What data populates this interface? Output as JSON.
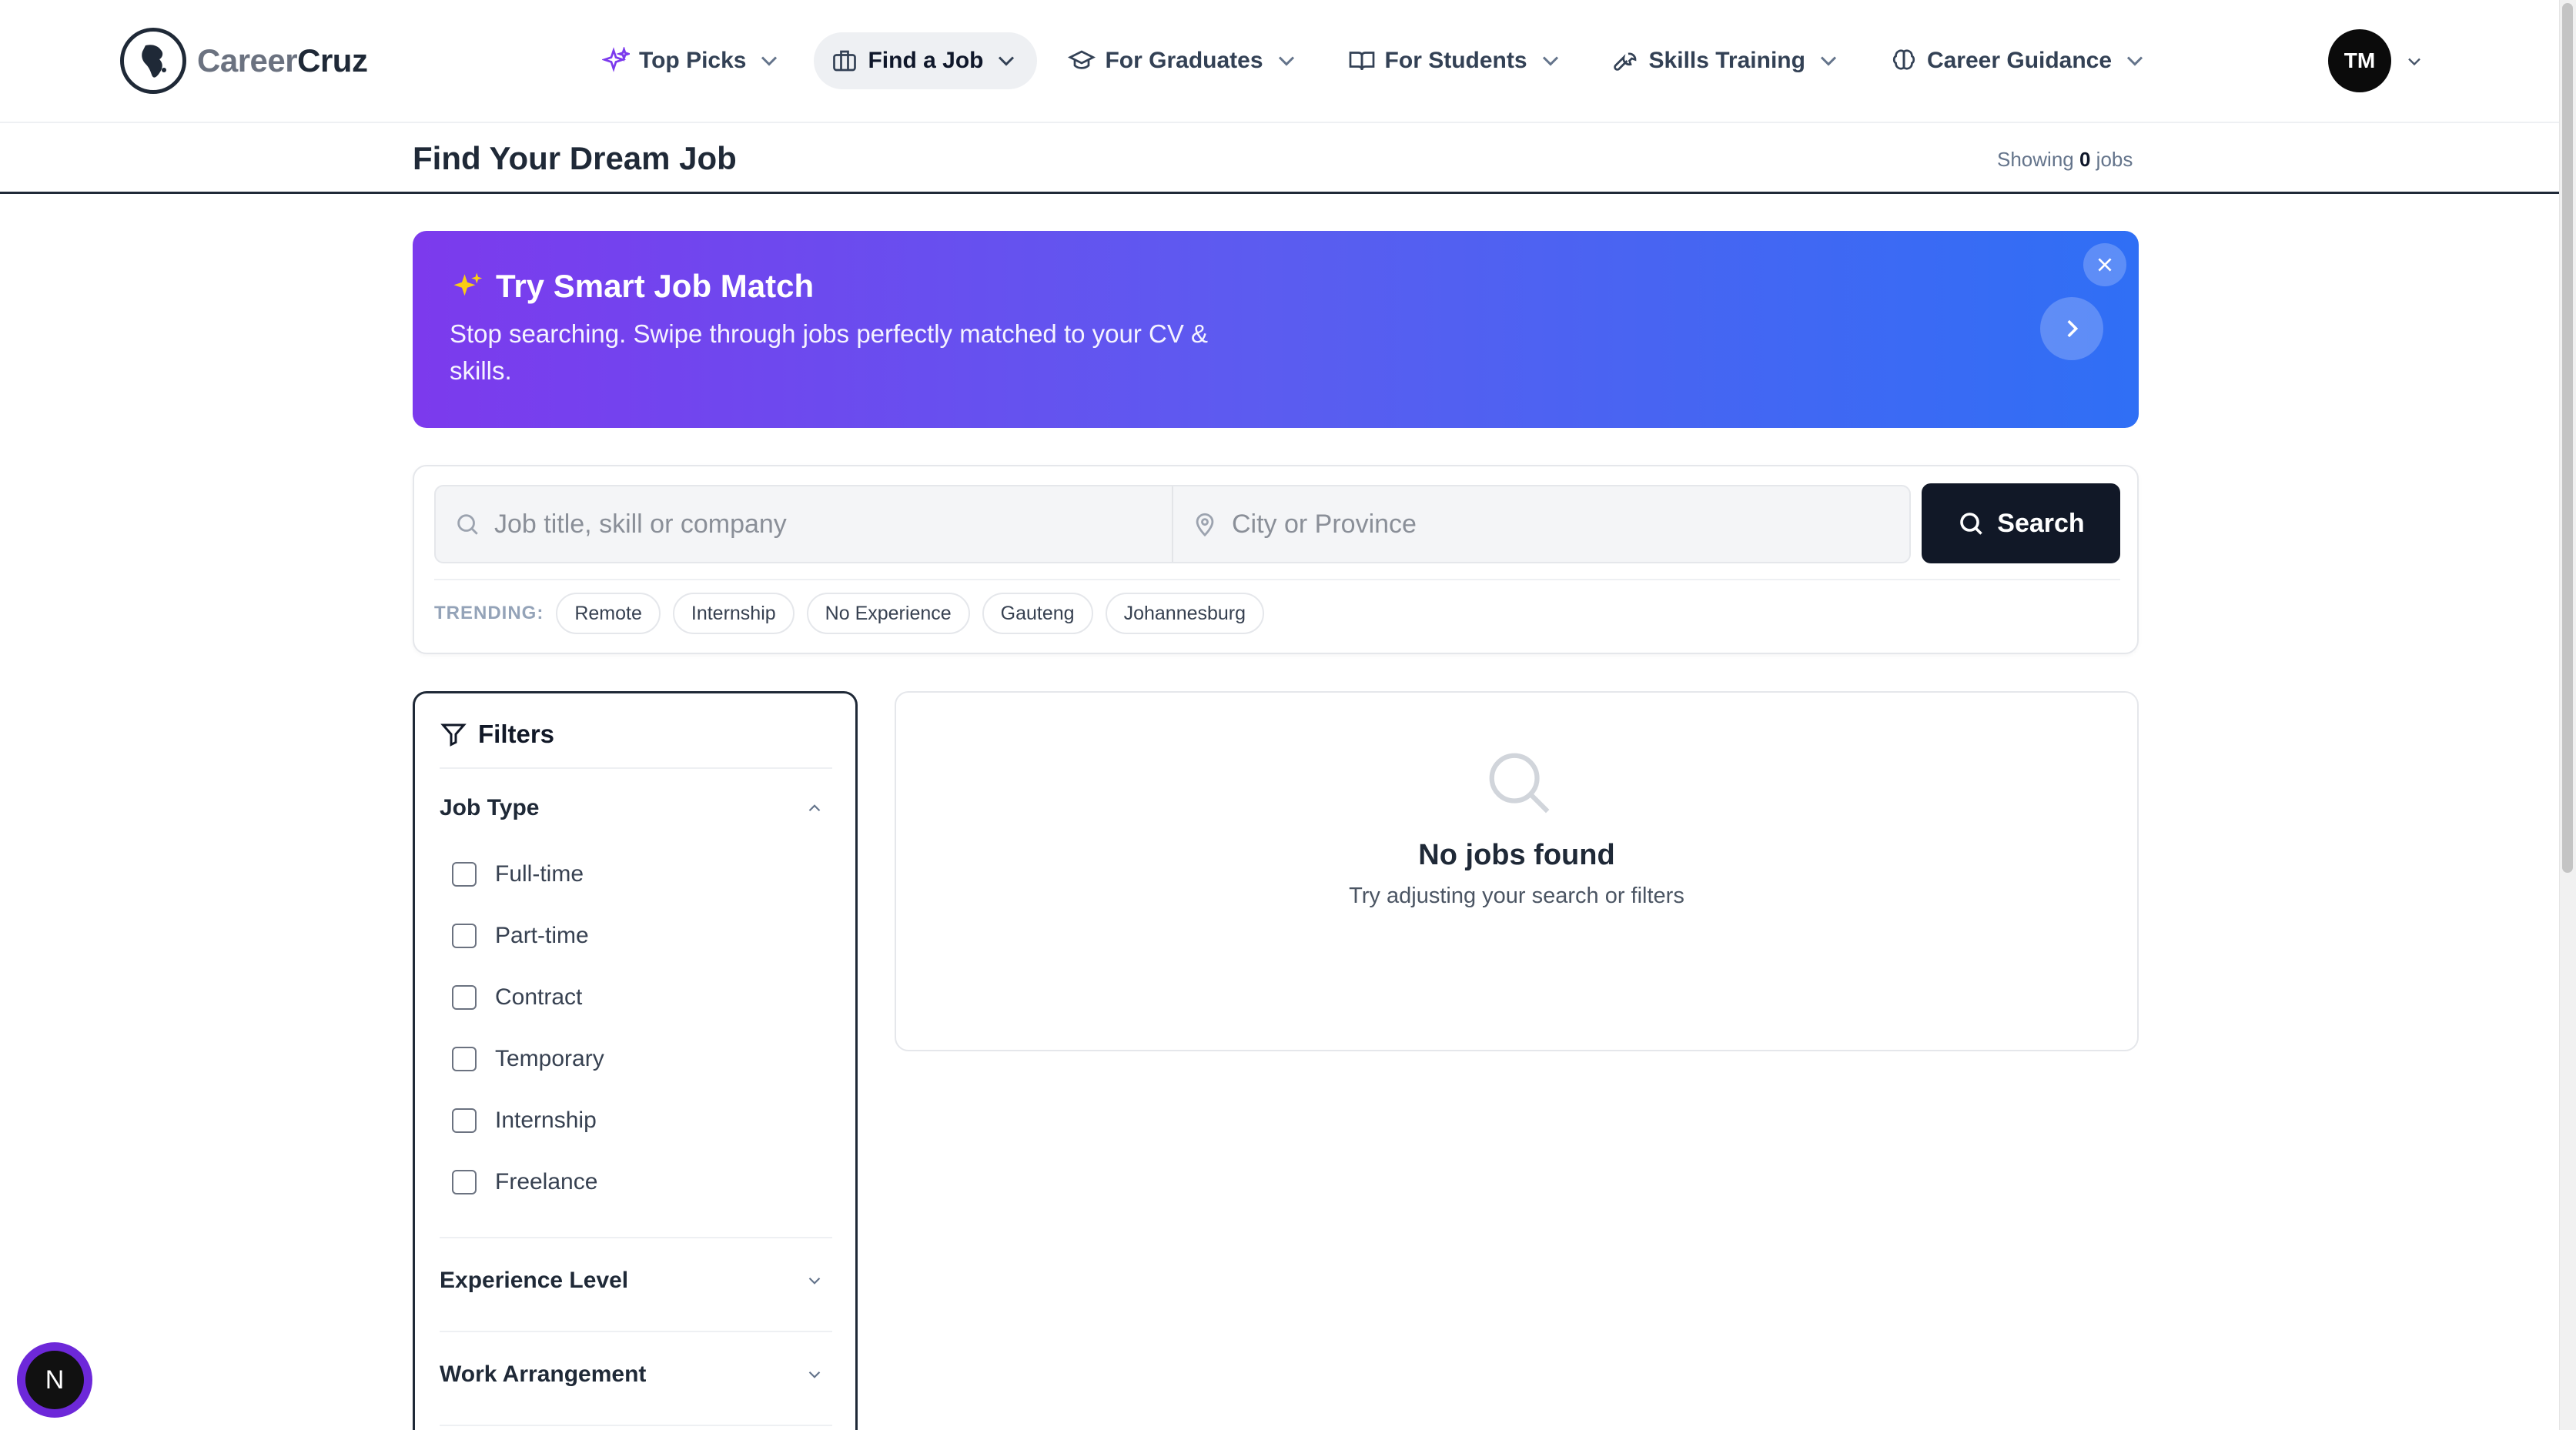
{
  "brand": {
    "name_part1": "Career",
    "name_part2": "Cruz"
  },
  "nav": {
    "items": [
      {
        "label": "Top Picks",
        "icon": "sparkles-icon"
      },
      {
        "label": "Find a Job",
        "icon": "briefcase-icon",
        "active": true
      },
      {
        "label": "For Graduates",
        "icon": "graduation-cap-icon"
      },
      {
        "label": "For Students",
        "icon": "book-open-icon"
      },
      {
        "label": "Skills Training",
        "icon": "wrench-icon"
      },
      {
        "label": "Career Guidance",
        "icon": "brain-icon"
      }
    ]
  },
  "user": {
    "initials": "TM"
  },
  "page": {
    "title": "Find Your Dream Job",
    "showing_prefix": "Showing ",
    "count": "0",
    "showing_suffix": " jobs"
  },
  "banner": {
    "title": "Try Smart Job Match",
    "text": "Stop searching. Swipe through jobs perfectly matched to your CV & skills.",
    "gradient": [
      "#7c3aed",
      "#2f6ff5"
    ]
  },
  "search": {
    "keyword_placeholder": "Job title, skill or company",
    "location_placeholder": "City or Province",
    "button_label": "Search",
    "trending_label": "TRENDING:",
    "trending": [
      "Remote",
      "Internship",
      "No Experience",
      "Gauteng",
      "Johannesburg"
    ]
  },
  "filters": {
    "title": "Filters",
    "job_type": {
      "label": "Job Type",
      "options": [
        "Full-time",
        "Part-time",
        "Contract",
        "Temporary",
        "Internship",
        "Freelance"
      ]
    },
    "experience_label": "Experience Level",
    "work_arrangement_label": "Work Arrangement"
  },
  "results": {
    "empty_title": "No jobs found",
    "empty_subtitle": "Try adjusting your search or filters"
  },
  "fab": {
    "letter": "N"
  }
}
